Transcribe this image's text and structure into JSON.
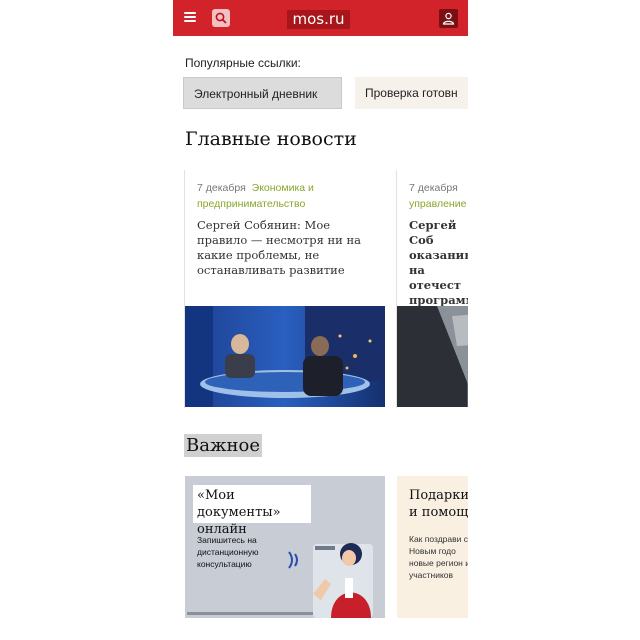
{
  "header": {
    "logo": "mos.ru",
    "colors": {
      "brand": "#d2232a"
    }
  },
  "popular": {
    "title": "Популярные ссылки:",
    "links": [
      "Электронный дневник",
      "Проверка готовн"
    ]
  },
  "news": {
    "title": "Главные новости",
    "cards": [
      {
        "date": "7 декабря",
        "category": "Экономика и предпринимательство",
        "headline": "Сергей Собянин: Мое правило — несмотря ни на какие проблемы, не останавливать развитие"
      },
      {
        "date": "7 декабря",
        "category": "",
        "category2": "управление",
        "headline": "Сергей Соб оказанию на отечест программ"
      }
    ]
  },
  "important": {
    "title": "Важное",
    "cards": [
      {
        "title": "«Мои документы» онлайн",
        "subtitle": "Запишитесь на дистанционную консультацию"
      },
      {
        "title": "Подарки, и помощ",
        "subtitle": "Как поздрави с Новым годо новые регион и участников"
      }
    ]
  }
}
